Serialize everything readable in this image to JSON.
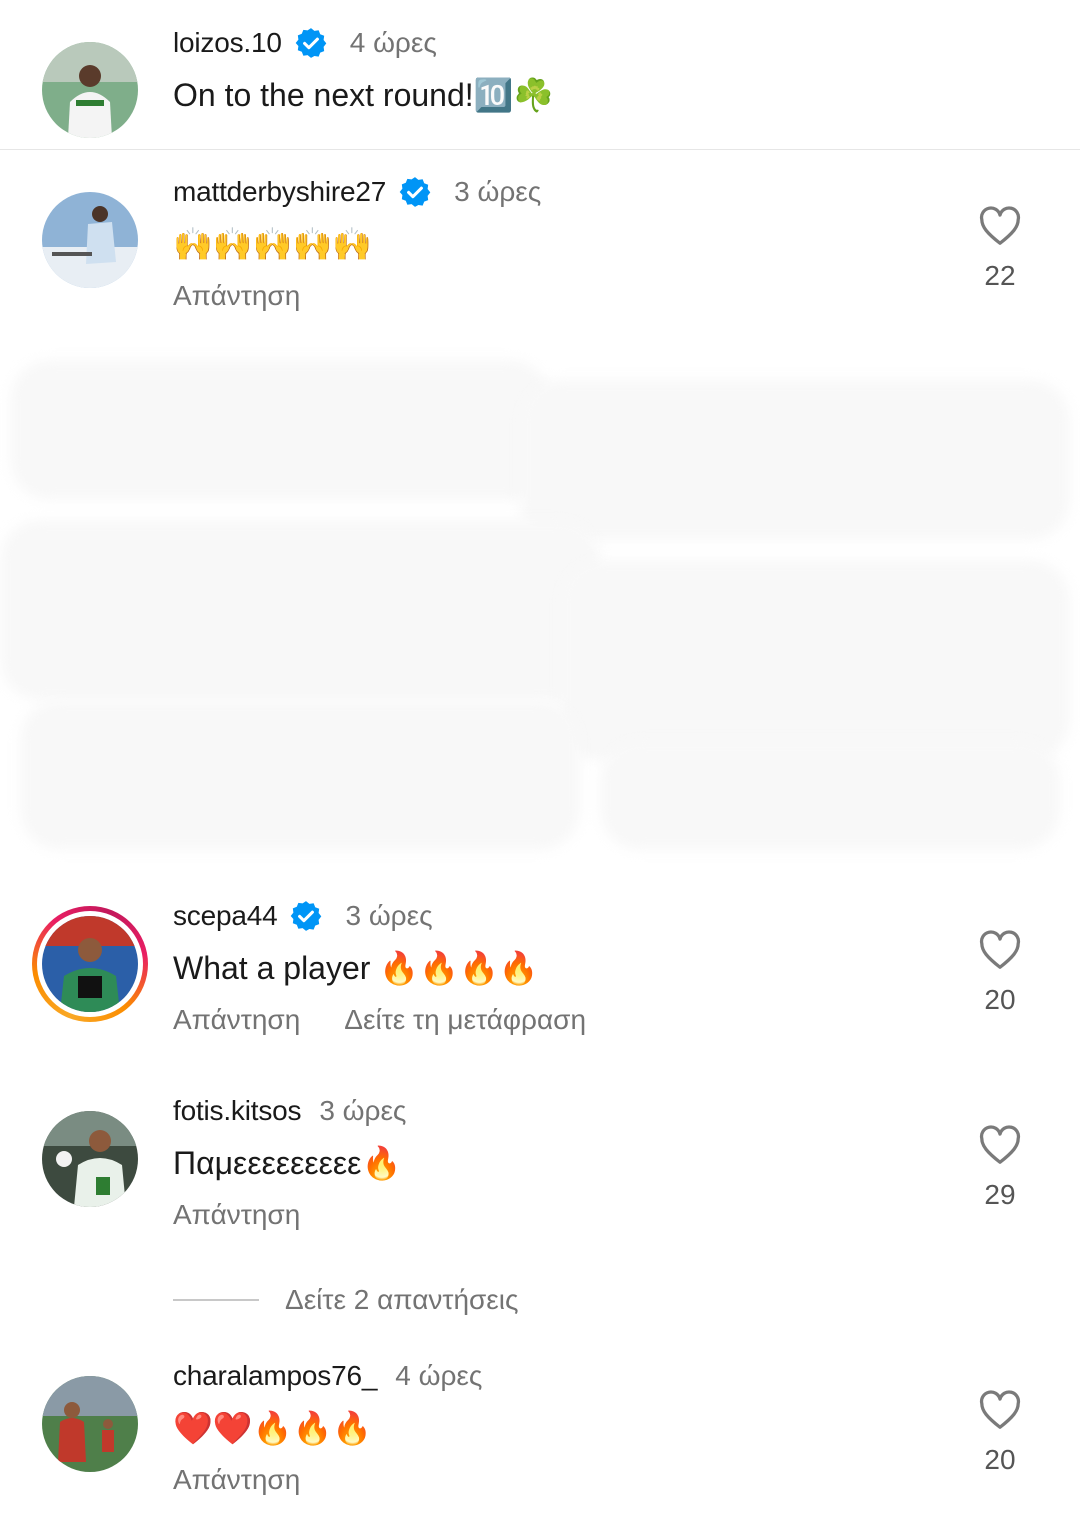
{
  "caption": {
    "username": "loizos.10",
    "verified": true,
    "time": "4 ώρες",
    "text": "On to the next round!🔟☘️"
  },
  "comments": [
    {
      "username": "mattderbyshire27",
      "verified": true,
      "time": "3 ώρες",
      "text": "🙌🙌🙌🙌🙌",
      "reply_label": "Απάντηση",
      "likes": "22"
    },
    {
      "username": "scepa44",
      "verified": true,
      "has_story": true,
      "time": "3 ώρες",
      "text": "What a player 🔥🔥🔥🔥",
      "reply_label": "Απάντηση",
      "translate_label": "Δείτε τη μετάφραση",
      "likes": "20"
    },
    {
      "username": "fotis.kitsos",
      "verified": false,
      "time": "3 ώρες",
      "text": "Παμεεεεεεεεε🔥",
      "reply_label": "Απάντηση",
      "likes": "29"
    },
    {
      "username": "charalampos76_",
      "verified": false,
      "time": "4 ώρες",
      "text": "❤️❤️🔥🔥🔥",
      "reply_label": "Απάντηση",
      "likes": "20"
    }
  ],
  "view_replies": "Δείτε 2 απαντήσεις",
  "colors": {
    "verified_blue": "#0095f6",
    "secondary_text": "#737373",
    "divider": "#e6e6e6"
  }
}
